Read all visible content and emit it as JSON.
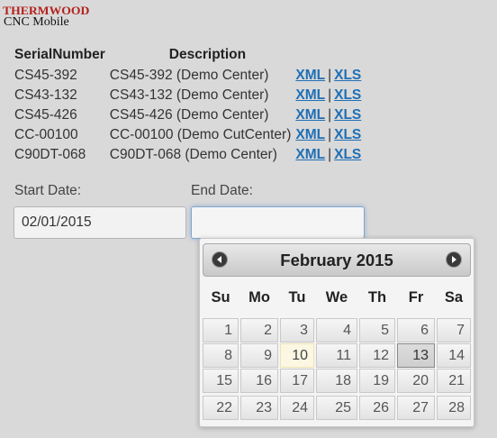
{
  "app": {
    "brand": "THERMWOOD",
    "subtitle": "CNC Mobile"
  },
  "table": {
    "headers": {
      "serial": "SerialNumber",
      "description": "Description"
    },
    "rows": [
      {
        "serial": "CS45-392",
        "description": "CS45-392 (Demo Center)",
        "xml": "XML",
        "xls": "XLS"
      },
      {
        "serial": "CS43-132",
        "description": "CS43-132 (Demo Center)",
        "xml": "XML",
        "xls": "XLS"
      },
      {
        "serial": "CS45-426",
        "description": "CS45-426 (Demo Center)",
        "xml": "XML",
        "xls": "XLS"
      },
      {
        "serial": "CC-00100",
        "description": "CC-00100 (Demo CutCenter)",
        "xml": "XML",
        "xls": "XLS"
      },
      {
        "serial": "C90DT-068",
        "description": "C90DT-068 (Demo Center)",
        "xml": "XML",
        "xls": "XLS"
      }
    ],
    "separator": "|"
  },
  "dates": {
    "start_label": "Start Date:",
    "start_value": "02/01/2015",
    "end_label": "End Date:",
    "end_value": ""
  },
  "calendar": {
    "month_title": "February 2015",
    "prev_icon": "circle-triangle-left-icon",
    "next_icon": "circle-triangle-right-icon",
    "weekdays": [
      "Su",
      "Mo",
      "Tu",
      "We",
      "Th",
      "Fr",
      "Sa"
    ],
    "weeks": [
      [
        "1",
        "2",
        "3",
        "4",
        "5",
        "6",
        "7"
      ],
      [
        "8",
        "9",
        "10",
        "11",
        "12",
        "13",
        "14"
      ],
      [
        "15",
        "16",
        "17",
        "18",
        "19",
        "20",
        "21"
      ],
      [
        "22",
        "23",
        "24",
        "25",
        "26",
        "27",
        "28"
      ]
    ],
    "today": "10",
    "selected": "13",
    "colors": {
      "link": "#1f6fb5",
      "brand": "#b3211d",
      "today_bg": "#fbf7e2"
    }
  }
}
